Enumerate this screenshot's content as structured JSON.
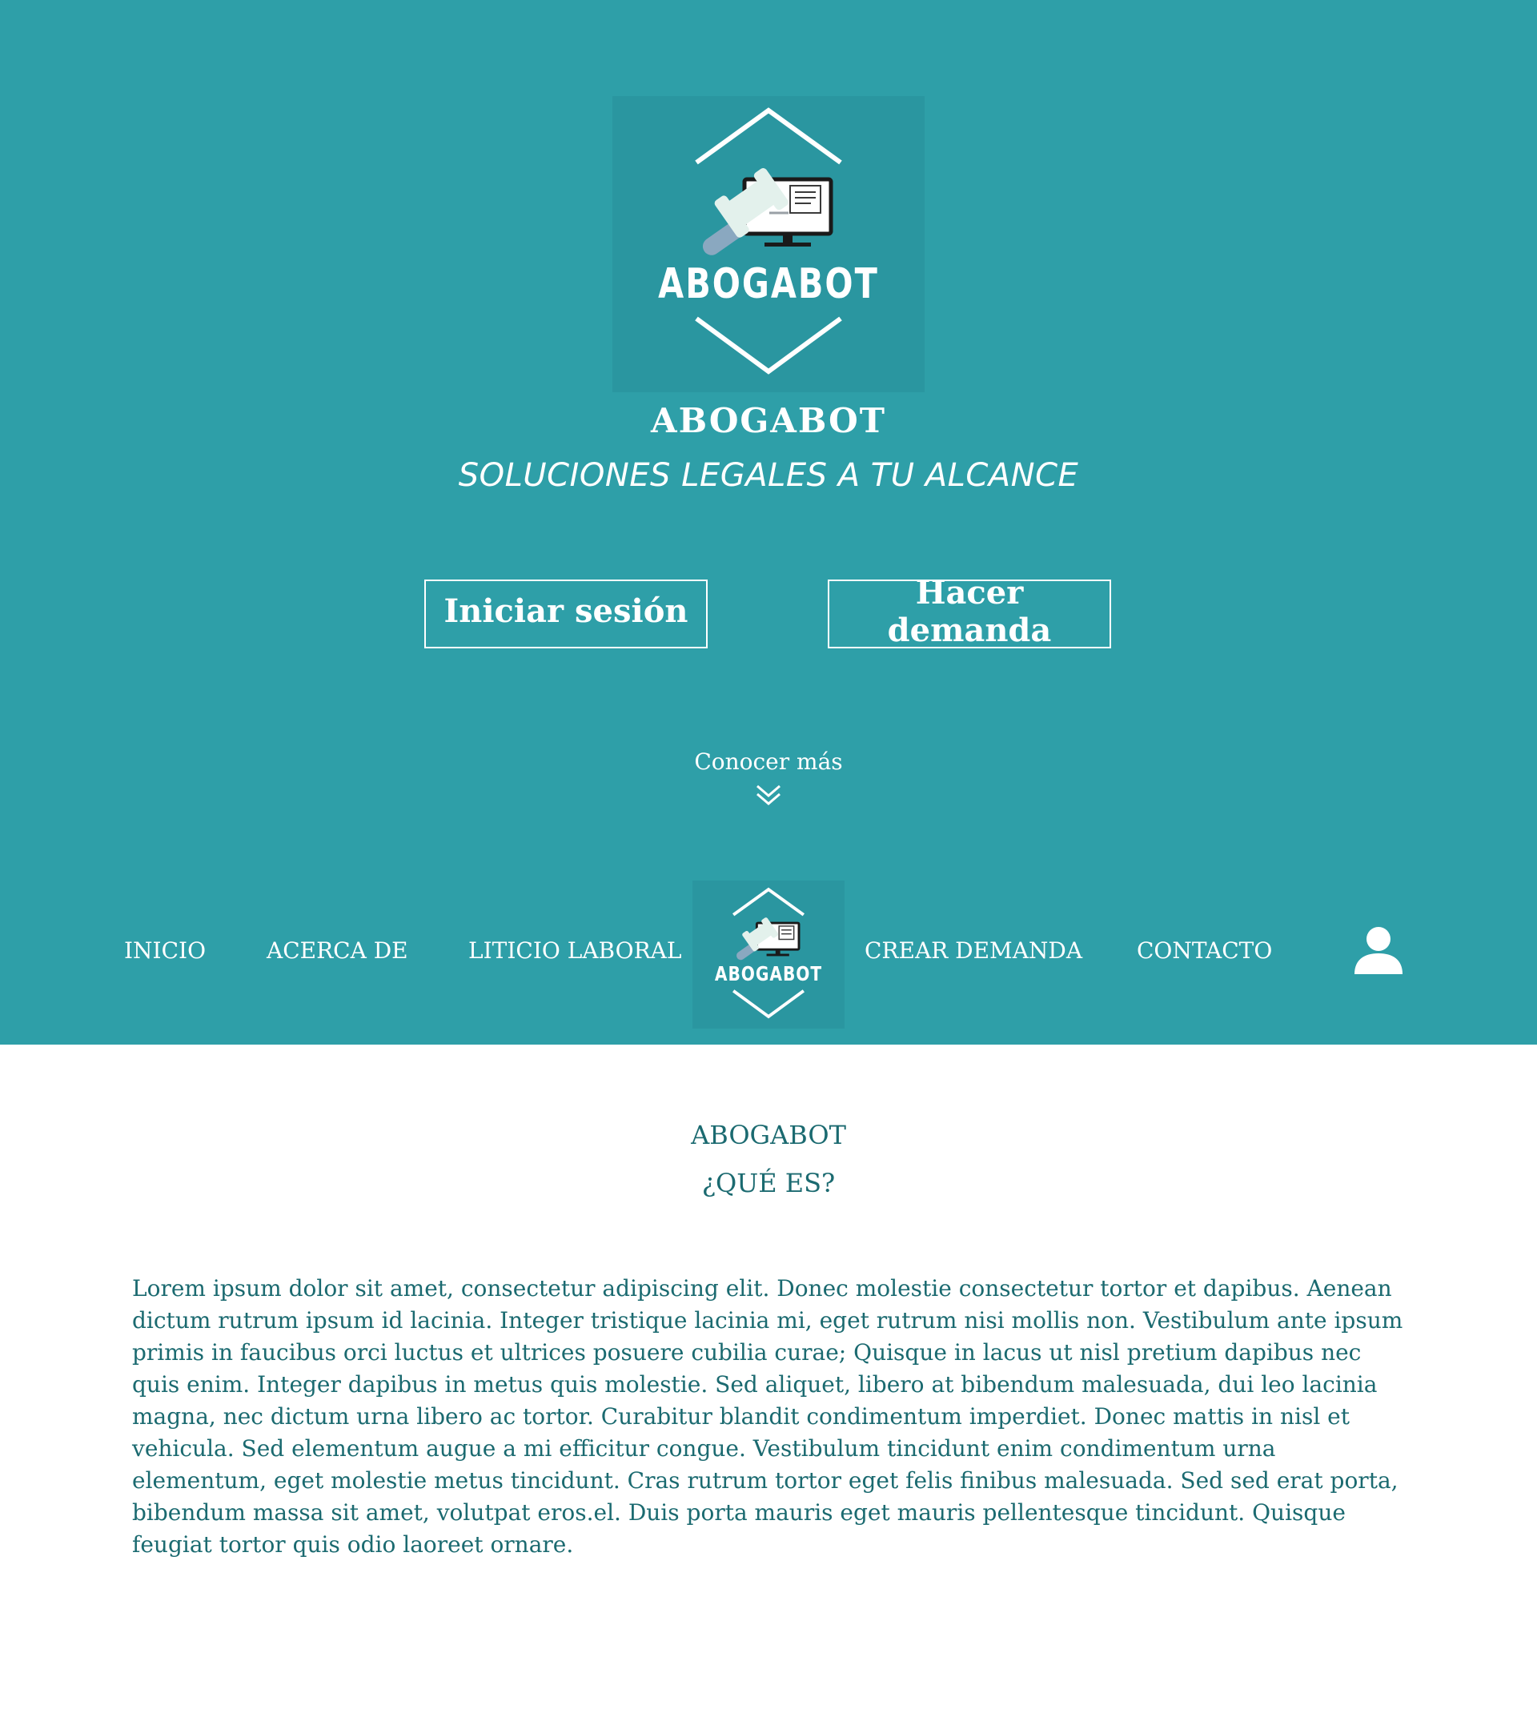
{
  "brand": {
    "logo_text": "ABOGABOT",
    "title": "ABOGABOT",
    "tagline": "SOLUCIONES LEGALES A TU ALCANCE"
  },
  "hero": {
    "login_label": "Iniciar sesión",
    "demand_label": "Hacer demanda",
    "more_label": "Conocer más",
    "more_icon": "double-chevron-down-icon"
  },
  "nav": {
    "items": [
      {
        "label": "INICIO"
      },
      {
        "label": "ACERCA DE"
      },
      {
        "label": "LITICIO LABORAL"
      },
      {
        "label": "CREAR DEMANDA"
      },
      {
        "label": "CONTACTO"
      }
    ],
    "user_icon": "user-icon"
  },
  "about": {
    "title": "ABOGABOT",
    "subtitle": "¿QUÉ ES?",
    "body": "Lorem ipsum dolor sit amet, consectetur adipiscing elit. Donec molestie consectetur tortor et dapibus. Aenean dictum rutrum ipsum id lacinia. Integer tristique lacinia mi, eget rutrum nisi mollis non. Vestibulum ante ipsum primis in faucibus orci luctus et ultrices posuere cubilia curae; Quisque in lacus ut nisl pretium dapibus nec quis enim. Integer dapibus in metus quis molestie. Sed aliquet, libero at bibendum malesuada, dui leo lacinia magna, nec dictum urna libero ac tortor. Curabitur blandit condimentum imperdiet. Donec mattis in nisl et vehicula. Sed elementum augue a mi efficitur congue. Vestibulum tincidunt enim condimentum urna elementum, eget molestie metus tincidunt. Cras rutrum tortor eget felis finibus malesuada. Sed sed erat porta, bibendum massa sit amet, volutpat eros.el. Duis porta mauris eget mauris pellentesque tincidunt. Quisque feugiat tortor quis odio laoreet ornare."
  },
  "colors": {
    "primary": "#2e9fa8",
    "logo_bg": "#2a96a0",
    "text_dark": "#1b6a70",
    "white": "#ffffff",
    "gavel_head": "#e3f1ec",
    "gavel_handle": "#8aa8c0"
  }
}
